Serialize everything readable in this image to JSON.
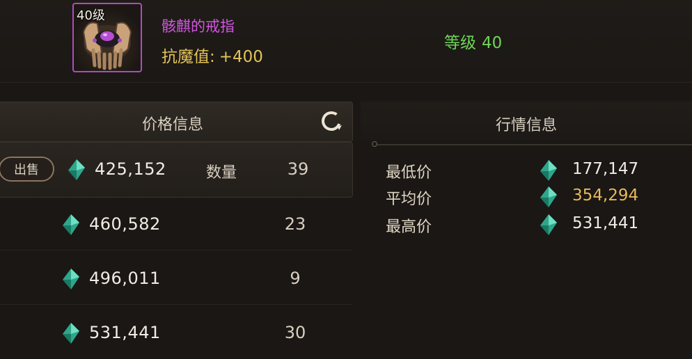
{
  "item": {
    "level_badge": "40级",
    "name": "骸麒的戒指",
    "stat_label": "抗魔值:",
    "stat_value": "+400",
    "grade_label": "等级",
    "grade_value": "40",
    "name_color": "#d256e0",
    "frame_color": "#b04bbd"
  },
  "price_panel": {
    "title": "价格信息",
    "refresh_icon": "refresh-icon",
    "sell_label": "出售",
    "quantity_label": "数量",
    "rows": [
      {
        "price": "425,152",
        "quantity": "39"
      },
      {
        "price": "460,582",
        "quantity": "23"
      },
      {
        "price": "496,011",
        "quantity": "9"
      },
      {
        "price": "531,441",
        "quantity": "30"
      }
    ]
  },
  "market_panel": {
    "title": "行情信息",
    "rows": [
      {
        "label": "最低价",
        "value": "177,147"
      },
      {
        "label": "平均价",
        "value": "354,294"
      },
      {
        "label": "最高价",
        "value": "531,441"
      }
    ]
  },
  "currency_icon": "gem-icon",
  "colors": {
    "price_text": "#f1ece4",
    "average_price": "#e8b85c",
    "grade_text": "#6fd45a",
    "stat_text": "#e3c35a"
  }
}
